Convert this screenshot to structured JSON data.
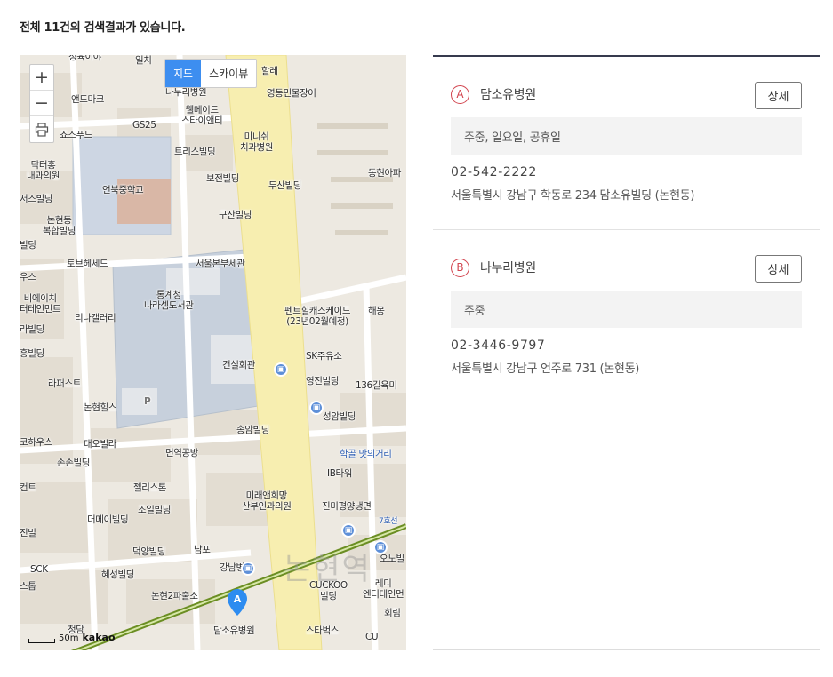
{
  "summary": "전체 11건의 검색결과가 있습니다.",
  "map": {
    "type_tabs": [
      "지도",
      "스카이뷰"
    ],
    "active_tab": "지도",
    "zoom_in": "+",
    "zoom_out": "−",
    "pin_letter": "A",
    "scale_text": "50m",
    "provider": "kakao",
    "labels": {
      "l1": "정육이야",
      "l2": "일치",
      "l3": "할레",
      "l4": "앤드마크",
      "l5": "나누리병원",
      "l6": "영동민물장어",
      "l7": "웰메이드\n스타이앤티",
      "l8": "GS25",
      "l9": "죠스푸드",
      "l10": "미니쉬\n치과병원",
      "l11": "닥터홍\n내과의원",
      "l12": "트리스빌딩",
      "l13": "보전빌딩",
      "l14": "두산빌딩",
      "l15": "동현아파",
      "l16": "언북중학교",
      "l17": "서스빌딩",
      "l18": "구산빌딩",
      "l19": "논현동\n복합빌딩",
      "l20": "토브헤세드",
      "l21": "서울본부세관",
      "l22": "통계청\n나라셈도서관",
      "l23": "비에이치\n터테인먼트",
      "l24": "리나갤러리",
      "l25": "펜트힐캐스케이드\n(23년02월예정)",
      "l26": "해몽",
      "l27": "SK주유소",
      "l28": "건설회관",
      "l29": "라퍼스트",
      "l30": "영진빌딩",
      "l31": "136길육미",
      "l32": "논현힐스",
      "l33": "성암빌딩",
      "l34": "송암빌딩",
      "l35": "대오빌라",
      "l36": "면역공방",
      "l37": "학골 맛의거리",
      "l38": "손손빌딩",
      "l39": "IB타워",
      "l40": "젤리스톤",
      "l41": "미래앤희망\n산부인과의원",
      "l42": "진미평양냉면",
      "l43": "조일빌딩",
      "l44": "더메이빌딩",
      "l45": "덕양빌딩",
      "l46": "남포",
      "l47": "강남병원",
      "l48": "오노빌",
      "l49": "SCK",
      "l50": "혜성빌딩",
      "l51": "CUCKOO\n빌딩",
      "l52": "레디\n엔터테인먼",
      "l53": "논현2파출소",
      "l54": "회림",
      "l55": "청담",
      "l56": "담소유병원",
      "l57": "스타벅스",
      "l58": "CU",
      "l59": "흥빌딩",
      "l60": "라빌딩",
      "l61": "코하우스",
      "l62": "진빌",
      "l63": "스톱",
      "l64": "컨트",
      "l65": "빌딩",
      "l66": "우스",
      "l67": "7호선",
      "l68": "논현역",
      "l69": "P"
    }
  },
  "results": [
    {
      "marker": "A",
      "name": "담소유병원",
      "detail_label": "상세",
      "holiday": "주중, 일요일, 공휴일",
      "phone": "02-542-2222",
      "address": "서울특별시 강남구 학동로 234 담소유빌딩 (논현동)"
    },
    {
      "marker": "B",
      "name": "나누리병원",
      "detail_label": "상세",
      "holiday": "주중",
      "phone": "02-3446-9797",
      "address": "서울특별시 강남구 언주로 731 (논현동)"
    }
  ],
  "colors": {
    "accent": "#3d8ef0",
    "marker": "#d24650",
    "road_main": "#f7eeb0",
    "subway_line": "#6b8e23"
  }
}
